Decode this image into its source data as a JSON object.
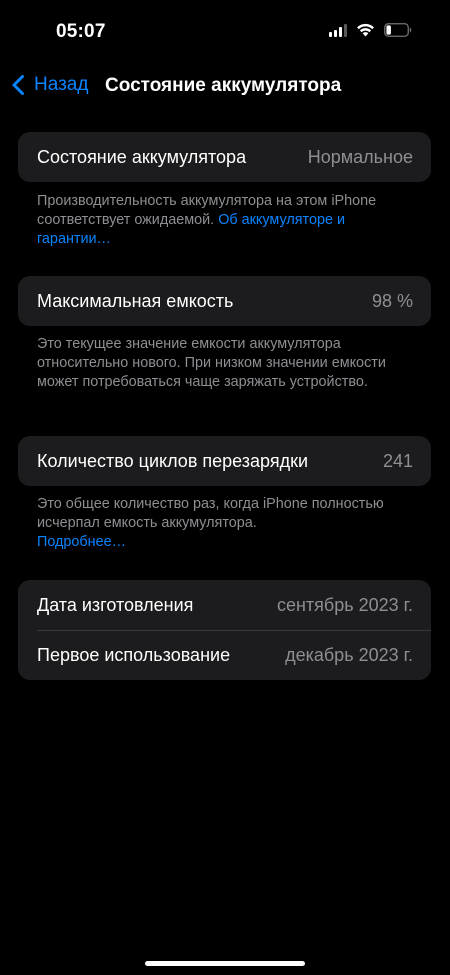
{
  "status_bar": {
    "time": "05:07",
    "icons": [
      "signal-icon",
      "wifi-icon",
      "battery-icon"
    ]
  },
  "nav": {
    "back_label": "Назад",
    "title": "Состояние аккумулятора"
  },
  "battery_health": {
    "label": "Состояние аккумулятора",
    "value": "Нормальное",
    "footer_text": "Производительность аккумулятора на этом iPhone соответствует ожидаемой.",
    "footer_link": "Об аккумуляторе и гарантии…"
  },
  "max_capacity": {
    "label": "Максимальная емкость",
    "value": "98 %",
    "footer_text": "Это текущее значение емкости аккумулятора относительно нового. При низком значении емкости может потребоваться чаще заряжать устройство."
  },
  "cycle_count": {
    "label": "Количество циклов перезарядки",
    "value": "241",
    "footer_text": "Это общее количество раз, когда iPhone полностью исчерпал емкость аккумулятора.",
    "footer_link": "Подробнее…"
  },
  "dates": {
    "manufacture_label": "Дата изготовления",
    "manufacture_value": "сентябрь 2023 г.",
    "first_use_label": "Первое использование",
    "first_use_value": "декабрь 2023 г."
  },
  "colors": {
    "background": "#000000",
    "cell": "#1c1c1e",
    "accent": "#0a84ff",
    "secondary_text": "#8e8e93"
  }
}
